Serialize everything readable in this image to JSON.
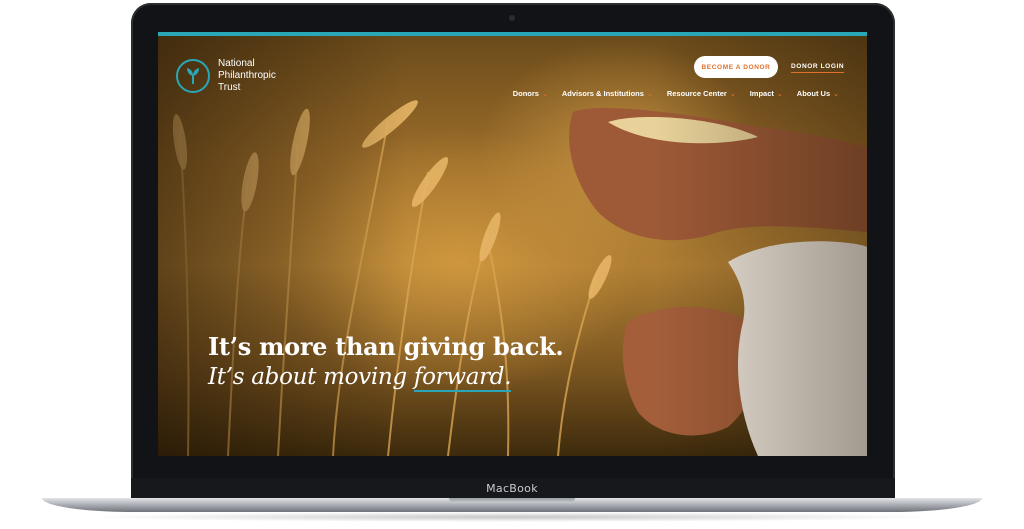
{
  "device": {
    "brand": "MacBook"
  },
  "site": {
    "logo_line1": "National",
    "logo_line2": "Philanthropic",
    "logo_line3": "Trust",
    "accent_color": "#2aa7b6",
    "cta_color": "#e0712a"
  },
  "header": {
    "cta_label": "BECOME A DONOR",
    "login_label": "DONOR LOGIN"
  },
  "nav": {
    "items": [
      "Donors",
      "Advisors & Institutions",
      "Resource Center",
      "Impact",
      "About Us"
    ]
  },
  "hero": {
    "line1": "It’s more than giving back.",
    "line2_prefix": "It’s about moving ",
    "line2_emphasis": "forward."
  },
  "icons": {
    "logo": "sprout-icon",
    "nav_dropdown": "chevron-down-icon"
  }
}
